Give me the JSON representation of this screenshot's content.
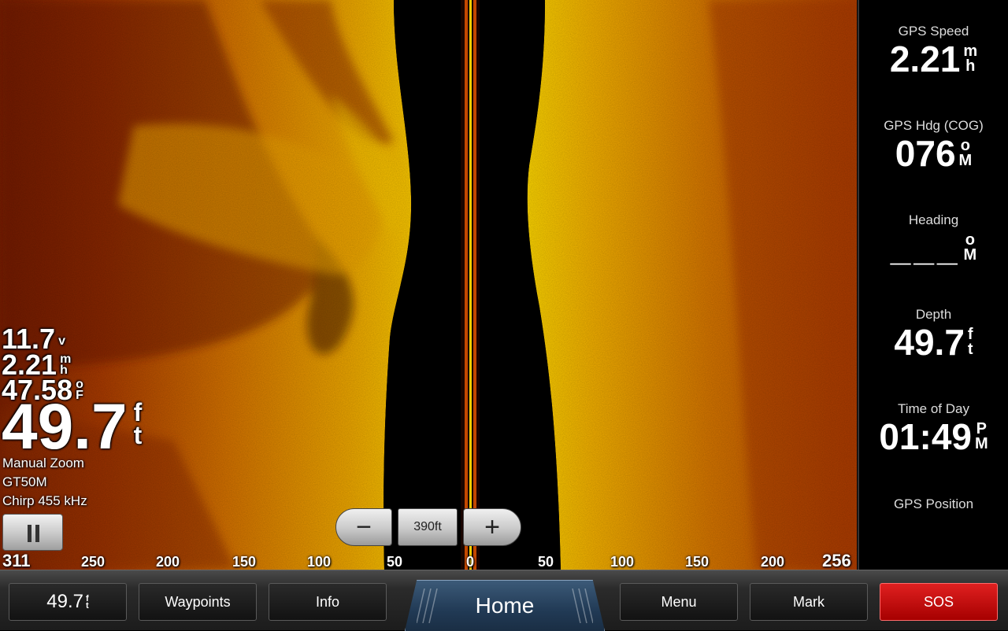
{
  "left_overlay": {
    "voltage": {
      "value": "11.7",
      "unit": [
        "v"
      ]
    },
    "speed": {
      "value": "2.21",
      "unit": [
        "m",
        "h"
      ]
    },
    "water_temp": {
      "value": "47.58",
      "unit": [
        "o",
        "F"
      ]
    },
    "depth": {
      "value": "49.7",
      "unit": [
        "f",
        "t"
      ]
    },
    "zoom_mode": "Manual Zoom",
    "transducer": "GT50M",
    "frequency": "Chirp 455 kHz"
  },
  "pause_button": {
    "icon": "pause-icon"
  },
  "zoom_control": {
    "zoom_out_label": "−",
    "range_label": "390ft",
    "zoom_in_label": "+"
  },
  "range_scale": {
    "left_end": "311",
    "right_end": "256",
    "ticks": [
      "250",
      "200",
      "150",
      "100",
      "50",
      "0",
      "50",
      "100",
      "150",
      "200"
    ]
  },
  "data_panel": {
    "gps_speed": {
      "label": "GPS Speed",
      "value": "2.21",
      "unit": [
        "m",
        "h"
      ]
    },
    "gps_heading": {
      "label": "GPS Hdg (COG)",
      "value": "076",
      "unit": [
        "o",
        "M"
      ]
    },
    "heading": {
      "label": "Heading",
      "value": "___",
      "unit": [
        "o",
        "M"
      ]
    },
    "depth": {
      "label": "Depth",
      "value": "49.7",
      "unit": [
        "f",
        "t"
      ]
    },
    "time_of_day": {
      "label": "Time of Day",
      "value": "01:49",
      "unit": [
        "P",
        "M"
      ]
    },
    "gps_position": {
      "label": "GPS Position"
    }
  },
  "bottom_bar": {
    "depth_button": {
      "value": "49.7",
      "unit": [
        "f",
        "t"
      ]
    },
    "waypoints": "Waypoints",
    "info": "Info",
    "home": "Home",
    "menu": "Menu",
    "mark": "Mark",
    "sos": "SOS"
  },
  "colors": {
    "sonar_dark": "#5a1400",
    "sonar_mid": "#c85a00",
    "sonar_bright": "#f5c000",
    "sos_red": "#cc0000",
    "home_blue": "#2b4a6a"
  }
}
